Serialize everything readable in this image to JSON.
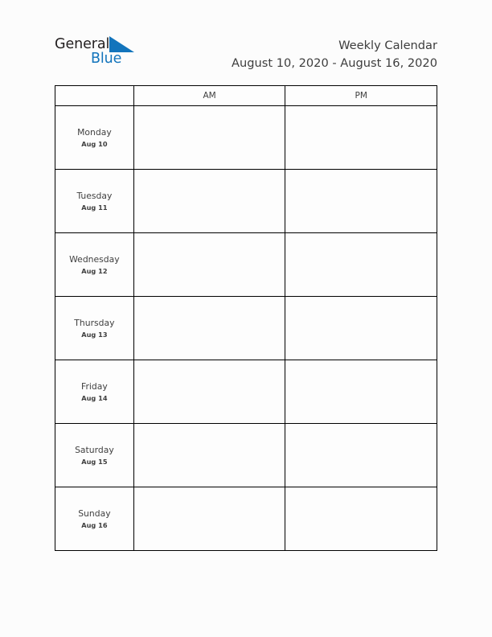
{
  "brand": {
    "name_part1": "General",
    "name_part2": "Blue",
    "triangle_color": "#1274bc",
    "text_color": "#231f20"
  },
  "header": {
    "title": "Weekly Calendar",
    "date_range": "August 10, 2020 - August 16, 2020"
  },
  "table": {
    "columns": [
      {
        "label": ""
      },
      {
        "label": "AM"
      },
      {
        "label": "PM"
      }
    ],
    "rows": [
      {
        "day": "Monday",
        "date": "Aug 10",
        "am": "",
        "pm": ""
      },
      {
        "day": "Tuesday",
        "date": "Aug 11",
        "am": "",
        "pm": ""
      },
      {
        "day": "Wednesday",
        "date": "Aug 12",
        "am": "",
        "pm": ""
      },
      {
        "day": "Thursday",
        "date": "Aug 13",
        "am": "",
        "pm": ""
      },
      {
        "day": "Friday",
        "date": "Aug 14",
        "am": "",
        "pm": ""
      },
      {
        "day": "Saturday",
        "date": "Aug 15",
        "am": "",
        "pm": ""
      },
      {
        "day": "Sunday",
        "date": "Aug 16",
        "am": "",
        "pm": ""
      }
    ]
  },
  "colors": {
    "page_background": "#fcfcfc",
    "border": "#000000",
    "text": "#3f3f3f",
    "accent": "#1274bc"
  }
}
